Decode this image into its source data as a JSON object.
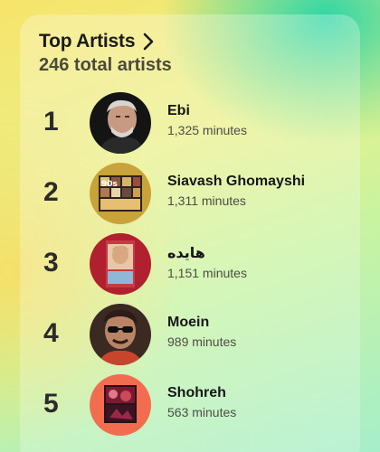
{
  "header": {
    "title": "Top Artists",
    "subtitle": "246 total artists"
  },
  "artists": [
    {
      "rank": "1",
      "name": "Ebi",
      "minutes": "1,325 minutes"
    },
    {
      "rank": "2",
      "name": "Siavash Ghomayshi",
      "minutes": "1,311 minutes"
    },
    {
      "rank": "3",
      "name": "هایده",
      "minutes": "1,151 minutes"
    },
    {
      "rank": "4",
      "name": "Moein",
      "minutes": "989 minutes"
    },
    {
      "rank": "5",
      "name": "Shohreh",
      "minutes": "563 minutes"
    }
  ],
  "colors": {
    "avatar_1_bg": "#1a1a1a",
    "avatar_2_bg": "#c9a23a",
    "avatar_3_bg": "#b0202e",
    "avatar_4_bg": "#3b2a22",
    "avatar_5_bg": "#f26d4f"
  }
}
